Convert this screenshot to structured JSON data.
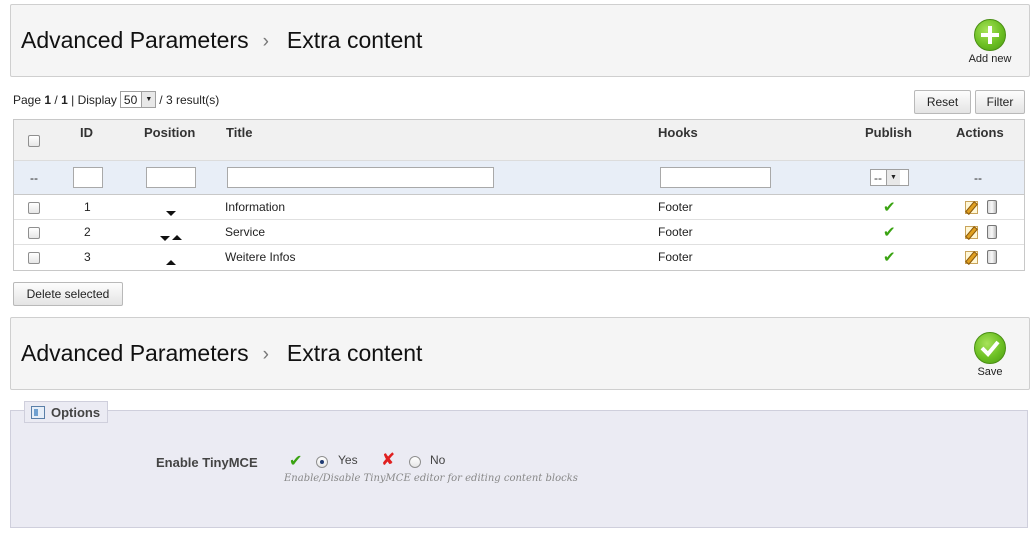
{
  "top_toolbar": {
    "crumb_1": "Advanced Parameters",
    "separator": "›",
    "crumb_2": "Extra content",
    "action_label": "Add new"
  },
  "pagination": {
    "page_word": "Page",
    "current_page": "1",
    "slash": "/",
    "total_pages": "1",
    "display_word": "| Display",
    "per_page": "50",
    "results": "/ 3 result(s)"
  },
  "list_buttons": {
    "reset": "Reset",
    "filter": "Filter",
    "delete_selected": "Delete selected"
  },
  "table": {
    "headers": {
      "id": "ID",
      "position": "Position",
      "title": "Title",
      "hooks": "Hooks",
      "publish": "Publish",
      "actions": "Actions"
    },
    "filter_row": {
      "bulk_placeholder": "--",
      "publish_select": "--",
      "actions_placeholder": "--"
    },
    "rows": [
      {
        "id": "1",
        "position_arrows": "down",
        "title": "Information",
        "hooks": "Footer",
        "published": true
      },
      {
        "id": "2",
        "position_arrows": "down-up",
        "title": "Service",
        "hooks": "Footer",
        "published": true
      },
      {
        "id": "3",
        "position_arrows": "up",
        "title": "Weitere Infos",
        "hooks": "Footer",
        "published": true
      }
    ]
  },
  "form_toolbar": {
    "crumb_1": "Advanced Parameters",
    "separator": "›",
    "crumb_2": "Extra content",
    "action_label": "Save"
  },
  "options": {
    "legend": "Options",
    "field_label": "Enable TinyMCE",
    "yes_label": "Yes",
    "no_label": "No",
    "selected": "Yes",
    "hint": "Enable/Disable TinyMCE editor for editing content blocks"
  },
  "colors": {
    "accent_green": "#6cbf23",
    "filter_row_bg": "#e8eef7",
    "options_bg": "#ebebf3",
    "no_red": "#e02020"
  },
  "icons": [
    "plus-circle-icon",
    "check-circle-icon",
    "sort-down-icon",
    "sort-up-icon",
    "published-check-icon",
    "edit-icon",
    "delete-icon",
    "options-icon",
    "yes-check-icon",
    "no-cross-icon"
  ]
}
